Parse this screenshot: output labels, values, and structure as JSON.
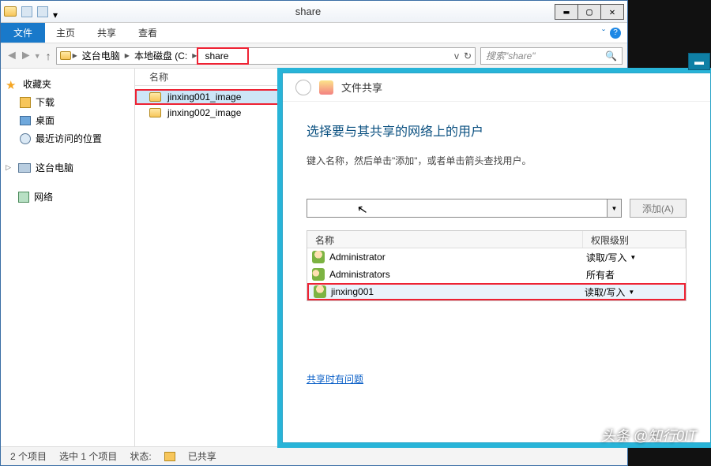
{
  "window": {
    "title": "share",
    "min": "▬",
    "max": "▢",
    "close": "✕"
  },
  "ribbon": {
    "file": "文件",
    "tabs": [
      "主页",
      "共享",
      "查看"
    ],
    "expand": "ˇ"
  },
  "nav": {
    "up": "↑",
    "crumbs": {
      "pc": "这台电脑",
      "disk": "本地磁盘 (C:",
      "share": "share"
    },
    "refresh": "↻",
    "dropdown": "v",
    "search_placeholder": "搜索\"share\"",
    "search_icon": "🔍"
  },
  "sidebar": {
    "favorites": "收藏夹",
    "items": [
      "下载",
      "桌面",
      "最近访问的位置"
    ],
    "pc": "这台电脑",
    "network": "网络"
  },
  "content": {
    "col_name": "名称",
    "files": [
      "jinxing001_image",
      "jinxing002_image"
    ]
  },
  "status": {
    "count": "2 个项目",
    "selected": "选中 1 个项目",
    "state_label": "状态:",
    "state": "已共享"
  },
  "dialog": {
    "title": "文件共享",
    "heading": "选择要与其共享的网络上的用户",
    "hint": "键入名称，然后单击\"添加\"，或者单击箭头查找用户。",
    "add_btn": "添加(A)",
    "col_name": "名称",
    "col_perm": "权限级别",
    "rows": [
      {
        "name": "Administrator",
        "perm": "读取/写入",
        "dd": "▼"
      },
      {
        "name": "Administrators",
        "perm": "所有者",
        "dd": ""
      },
      {
        "name": "jinxing001",
        "perm": "读取/写入",
        "dd": "▼"
      }
    ],
    "link": "共享时有问题",
    "min": "▬"
  },
  "watermark": "头条 @知行0IT"
}
